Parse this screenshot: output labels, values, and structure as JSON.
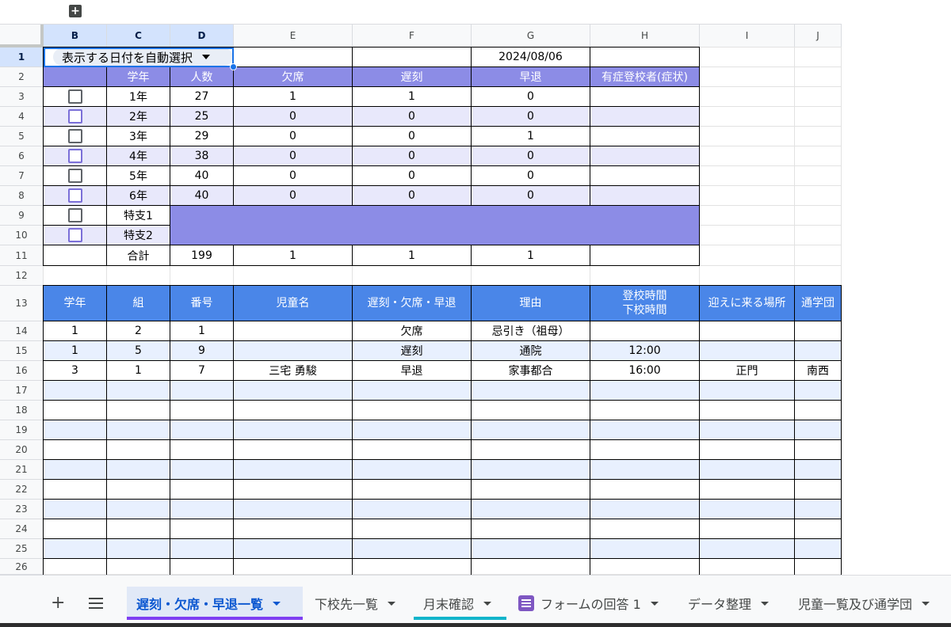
{
  "toolbar": {
    "group_toggle": "+"
  },
  "columns": [
    "B",
    "C",
    "D",
    "E",
    "F",
    "G",
    "H",
    "I",
    "J"
  ],
  "rows": [
    "1",
    "2",
    "3",
    "4",
    "5",
    "6",
    "7",
    "8",
    "9",
    "10",
    "11",
    "12",
    "13",
    "14",
    "15",
    "16",
    "17",
    "18",
    "19",
    "20",
    "21",
    "22",
    "23",
    "24",
    "25",
    "26"
  ],
  "summary": {
    "date_selector_label": "表示する日付を自動選択",
    "date": "2024/08/06",
    "headers": [
      "学年",
      "人数",
      "欠席",
      "遅刻",
      "早退",
      "有症登校者(症状)"
    ],
    "grades": [
      {
        "grade": "1年",
        "count": "27",
        "absent": "1",
        "late": "1",
        "early": "0"
      },
      {
        "grade": "2年",
        "count": "25",
        "absent": "0",
        "late": "0",
        "early": "0"
      },
      {
        "grade": "3年",
        "count": "29",
        "absent": "0",
        "late": "0",
        "early": "1"
      },
      {
        "grade": "4年",
        "count": "38",
        "absent": "0",
        "late": "0",
        "early": "0"
      },
      {
        "grade": "5年",
        "count": "40",
        "absent": "0",
        "late": "0",
        "early": "0"
      },
      {
        "grade": "6年",
        "count": "40",
        "absent": "0",
        "late": "0",
        "early": "0"
      }
    ],
    "special": [
      "特支1",
      "特支2"
    ],
    "total": {
      "label": "合計",
      "count": "199",
      "absent": "1",
      "late": "1",
      "early": "1"
    }
  },
  "detail": {
    "headers": [
      "学年",
      "組",
      "番号",
      "児童名",
      "遅刻・欠席・早退",
      "理由",
      "登校時間\n下校時間",
      "迎えに来る場所",
      "通学団"
    ],
    "rows": [
      [
        "1",
        "2",
        "1",
        "",
        "欠席",
        "忌引き（祖母）",
        "",
        "",
        ""
      ],
      [
        "1",
        "5",
        "9",
        "",
        "遅刻",
        "通院",
        "12:00",
        "",
        ""
      ],
      [
        "3",
        "1",
        "7",
        "三宅 勇駿",
        "早退",
        "家事都合",
        "16:00",
        "正門",
        "南西"
      ]
    ]
  },
  "sheet_tabs": {
    "add_label": "+",
    "tabs": [
      {
        "label": "遅刻・欠席・早退一覧",
        "active": true
      },
      {
        "label": "下校先一覧"
      },
      {
        "label": "月末確認"
      },
      {
        "label": "フォームの回答 1"
      },
      {
        "label": "データ整理"
      },
      {
        "label": "児童一覧及び通学団"
      }
    ]
  },
  "colors": {
    "header_purple": "#8c8ce6",
    "header_blue": "#4a86e8",
    "lavender_row": "#e8e8fb",
    "light_blue_row": "#e8f0fe",
    "selection": "#1a73e8"
  }
}
